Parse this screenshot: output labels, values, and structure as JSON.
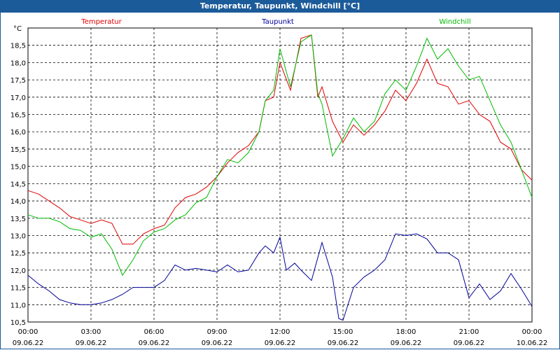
{
  "window": {
    "title": "Temperatur, Taupunkt, Windchill [°C]"
  },
  "chart_data": {
    "type": "line",
    "title": "Temperatur, Taupunkt, Windchill [°C]",
    "y_unit": "°C",
    "ylim": [
      10.5,
      19.0
    ],
    "y_ticks": [
      "10,5",
      "11,0",
      "11,5",
      "12,0",
      "12,5",
      "13,0",
      "13,5",
      "14,0",
      "14,5",
      "15,0",
      "15,5",
      "16,0",
      "16,5",
      "17,0",
      "17,5",
      "18,0",
      "18,5"
    ],
    "x_ticks": [
      {
        "time": "00:00",
        "date": "09.06.22"
      },
      {
        "time": "03:00",
        "date": "09.06.22"
      },
      {
        "time": "06:00",
        "date": "09.06.22"
      },
      {
        "time": "09:00",
        "date": "09.06.22"
      },
      {
        "time": "12:00",
        "date": "09.06.22"
      },
      {
        "time": "15:00",
        "date": "09.06.22"
      },
      {
        "time": "18:00",
        "date": "09.06.22"
      },
      {
        "time": "21:00",
        "date": "09.06.22"
      },
      {
        "time": "00:00",
        "date": "10.06.22"
      }
    ],
    "grid": true,
    "legend_placement": "top",
    "series": [
      {
        "name": "Temperatur",
        "color": "#e00000",
        "points": [
          [
            0,
            14.3
          ],
          [
            0.5,
            14.2
          ],
          [
            1,
            14.0
          ],
          [
            1.5,
            13.8
          ],
          [
            2,
            13.55
          ],
          [
            2.5,
            13.45
          ],
          [
            3,
            13.35
          ],
          [
            3.5,
            13.45
          ],
          [
            4,
            13.35
          ],
          [
            4.5,
            12.75
          ],
          [
            5,
            12.75
          ],
          [
            5.5,
            13.05
          ],
          [
            6,
            13.2
          ],
          [
            6.5,
            13.3
          ],
          [
            7,
            13.8
          ],
          [
            7.5,
            14.1
          ],
          [
            8,
            14.2
          ],
          [
            8.5,
            14.4
          ],
          [
            9,
            14.7
          ],
          [
            9.5,
            15.1
          ],
          [
            10,
            15.4
          ],
          [
            10.5,
            15.6
          ],
          [
            11,
            16.0
          ],
          [
            11.3,
            16.9
          ],
          [
            11.7,
            17.0
          ],
          [
            12,
            18.0
          ],
          [
            12.5,
            17.2
          ],
          [
            13,
            18.7
          ],
          [
            13.5,
            18.8
          ],
          [
            13.8,
            17.0
          ],
          [
            14,
            17.3
          ],
          [
            14.5,
            16.3
          ],
          [
            15,
            15.7
          ],
          [
            15.5,
            16.2
          ],
          [
            16,
            15.9
          ],
          [
            16.5,
            16.2
          ],
          [
            17,
            16.6
          ],
          [
            17.5,
            17.2
          ],
          [
            18,
            16.9
          ],
          [
            18.5,
            17.4
          ],
          [
            19,
            18.1
          ],
          [
            19.5,
            17.4
          ],
          [
            20,
            17.3
          ],
          [
            20.5,
            16.8
          ],
          [
            21,
            16.9
          ],
          [
            21.5,
            16.5
          ],
          [
            22,
            16.3
          ],
          [
            22.5,
            15.7
          ],
          [
            23,
            15.5
          ],
          [
            23.5,
            14.9
          ],
          [
            24,
            14.6
          ]
        ]
      },
      {
        "name": "Taupunkt",
        "color": "#000099",
        "points": [
          [
            0,
            11.85
          ],
          [
            0.5,
            11.6
          ],
          [
            1,
            11.4
          ],
          [
            1.5,
            11.15
          ],
          [
            2,
            11.05
          ],
          [
            2.5,
            11.0
          ],
          [
            3,
            11.0
          ],
          [
            3.5,
            11.05
          ],
          [
            4,
            11.15
          ],
          [
            4.5,
            11.3
          ],
          [
            5,
            11.5
          ],
          [
            5.5,
            11.5
          ],
          [
            6,
            11.5
          ],
          [
            6.5,
            11.7
          ],
          [
            7,
            12.15
          ],
          [
            7.5,
            12.0
          ],
          [
            8,
            12.05
          ],
          [
            8.5,
            12.0
          ],
          [
            9,
            11.95
          ],
          [
            9.5,
            12.15
          ],
          [
            10,
            11.95
          ],
          [
            10.5,
            12.0
          ],
          [
            11,
            12.5
          ],
          [
            11.3,
            12.7
          ],
          [
            11.7,
            12.5
          ],
          [
            12,
            12.95
          ],
          [
            12.3,
            12.0
          ],
          [
            12.7,
            12.2
          ],
          [
            13,
            12.0
          ],
          [
            13.5,
            11.7
          ],
          [
            14,
            12.8
          ],
          [
            14.5,
            11.8
          ],
          [
            14.8,
            10.6
          ],
          [
            15,
            10.55
          ],
          [
            15.5,
            11.5
          ],
          [
            16,
            11.8
          ],
          [
            16.5,
            12.0
          ],
          [
            17,
            12.3
          ],
          [
            17.5,
            13.05
          ],
          [
            18,
            13.0
          ],
          [
            18.5,
            13.05
          ],
          [
            19,
            12.9
          ],
          [
            19.5,
            12.5
          ],
          [
            20,
            12.5
          ],
          [
            20.5,
            12.3
          ],
          [
            21,
            11.2
          ],
          [
            21.5,
            11.6
          ],
          [
            22,
            11.15
          ],
          [
            22.5,
            11.4
          ],
          [
            23,
            11.9
          ],
          [
            23.5,
            11.45
          ],
          [
            24,
            10.95
          ]
        ]
      },
      {
        "name": "Windchill",
        "color": "#00bb00",
        "points": [
          [
            0,
            13.6
          ],
          [
            0.5,
            13.5
          ],
          [
            1,
            13.5
          ],
          [
            1.5,
            13.4
          ],
          [
            2,
            13.2
          ],
          [
            2.5,
            13.15
          ],
          [
            3,
            12.95
          ],
          [
            3.5,
            13.05
          ],
          [
            4,
            12.6
          ],
          [
            4.5,
            11.85
          ],
          [
            5,
            12.3
          ],
          [
            5.5,
            12.85
          ],
          [
            6,
            13.1
          ],
          [
            6.5,
            13.2
          ],
          [
            7,
            13.45
          ],
          [
            7.5,
            13.6
          ],
          [
            8,
            13.95
          ],
          [
            8.5,
            14.1
          ],
          [
            9,
            14.7
          ],
          [
            9.5,
            15.2
          ],
          [
            10,
            15.1
          ],
          [
            10.5,
            15.4
          ],
          [
            11,
            16.0
          ],
          [
            11.3,
            16.9
          ],
          [
            11.7,
            17.2
          ],
          [
            12,
            18.4
          ],
          [
            12.5,
            17.3
          ],
          [
            13,
            18.6
          ],
          [
            13.5,
            18.8
          ],
          [
            13.8,
            17.1
          ],
          [
            14,
            16.8
          ],
          [
            14.5,
            15.3
          ],
          [
            15,
            15.8
          ],
          [
            15.5,
            16.4
          ],
          [
            16,
            16.0
          ],
          [
            16.5,
            16.3
          ],
          [
            17,
            17.1
          ],
          [
            17.5,
            17.5
          ],
          [
            18,
            17.2
          ],
          [
            18.5,
            17.9
          ],
          [
            19,
            18.7
          ],
          [
            19.5,
            18.1
          ],
          [
            20,
            18.4
          ],
          [
            20.5,
            17.9
          ],
          [
            21,
            17.5
          ],
          [
            21.5,
            17.6
          ],
          [
            22,
            16.9
          ],
          [
            22.5,
            16.2
          ],
          [
            23,
            15.7
          ],
          [
            23.5,
            14.9
          ],
          [
            24,
            14.1
          ]
        ]
      }
    ]
  }
}
